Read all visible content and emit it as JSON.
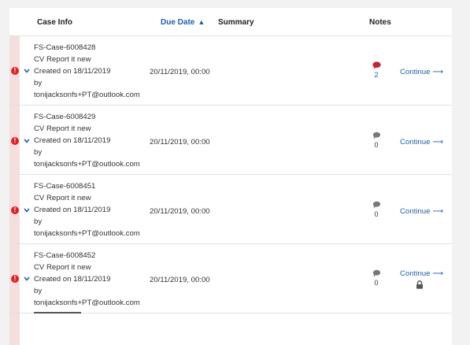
{
  "header": {
    "case_info": "Case Info",
    "due_date": "Due Date",
    "summary": "Summary",
    "notes": "Notes"
  },
  "rows": [
    {
      "case_id": "FS-Case-6008428",
      "report": "CV Report it new",
      "created": "Created on 18/11/2019",
      "by": "by",
      "email": "tonijacksonfs+PT@outlook.com",
      "due": "20/11/2019, 00:00",
      "notes_count": "2",
      "continue": "Continue",
      "locked": false
    },
    {
      "case_id": "FS-Case-6008429",
      "report": "CV Report it new",
      "created": "Created on 18/11/2019",
      "by": "by",
      "email": "tonijacksonfs+PT@outlook.com",
      "due": "20/11/2019, 00:00",
      "notes_count": "0",
      "continue": "Continue",
      "locked": false
    },
    {
      "case_id": "FS-Case-6008451",
      "report": "CV Report it new",
      "created": "Created on 18/11/2019",
      "by": "by",
      "email": "tonijacksonfs+PT@outlook.com",
      "due": "20/11/2019, 00:00",
      "notes_count": "0",
      "continue": "Continue",
      "locked": false
    },
    {
      "case_id": "FS-Case-6008452",
      "report": "CV Report it new",
      "created": "Created on 18/11/2019",
      "by": "by",
      "email": "tonijacksonfs+PT@outlook.com",
      "due": "20/11/2019, 00:00",
      "notes_count": "0",
      "continue": "Continue",
      "locked": true
    }
  ],
  "colors": {
    "accent": "#1f5fa8",
    "alert": "#d9262b",
    "stripe": "#f4dede",
    "notes_active": "#c0282d",
    "notes_inactive": "#777777"
  },
  "icons": {
    "alert": "exclamation-circle-icon",
    "expand": "chevron-down-icon",
    "sort": "sort-icon",
    "notes": "comment-icon",
    "continue": "arrow-right-icon",
    "lock": "lock-icon"
  }
}
